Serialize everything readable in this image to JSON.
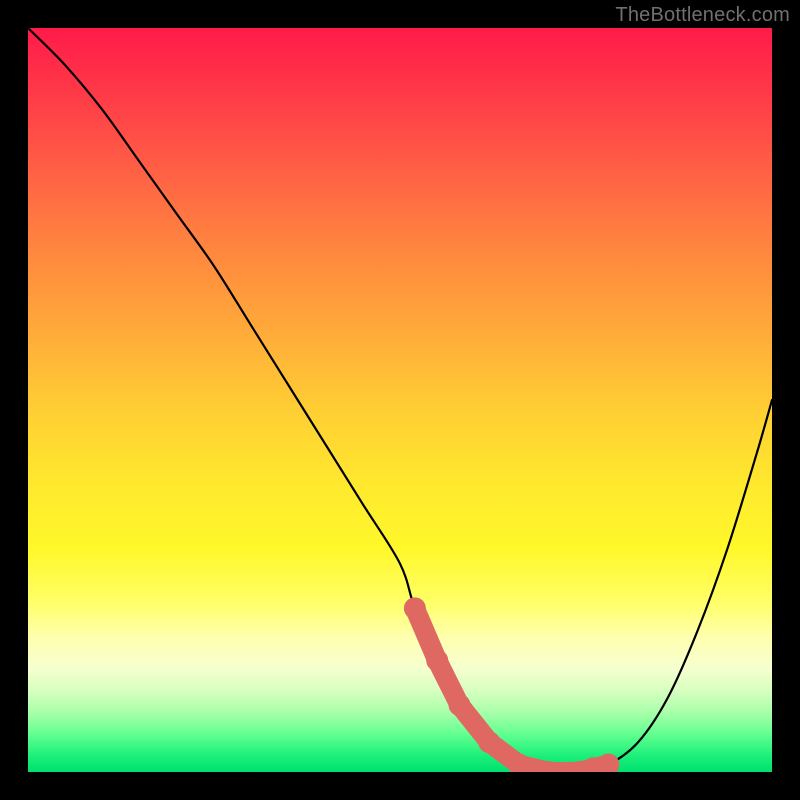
{
  "watermark": "TheBottleneck.com",
  "chart_data": {
    "type": "line",
    "title": "",
    "xlabel": "",
    "ylabel": "",
    "xlim": [
      0,
      100
    ],
    "ylim": [
      0,
      100
    ],
    "grid": false,
    "series": [
      {
        "name": "bottleneck-curve",
        "x": [
          0,
          5,
          10,
          15,
          20,
          25,
          30,
          35,
          40,
          45,
          50,
          52,
          55,
          58,
          62,
          66,
          70,
          74,
          78,
          82,
          86,
          90,
          94,
          98,
          100
        ],
        "y": [
          100,
          95,
          89,
          82,
          75,
          68,
          60,
          52,
          44,
          36,
          28,
          22,
          15,
          9,
          4,
          1,
          0,
          0,
          1,
          4,
          10,
          19,
          30,
          43,
          50
        ]
      }
    ],
    "optimal_markers": {
      "name": "optimal-range",
      "x": [
        52,
        55,
        58,
        62,
        66,
        70,
        74,
        76,
        78
      ],
      "y": [
        22,
        15,
        9,
        4,
        1,
        0,
        0,
        0.5,
        1
      ]
    },
    "gradient_scale": {
      "description": "vertical red-to-green bottleneck severity",
      "stops": [
        {
          "pos": 0,
          "color": "#ff1a4a"
        },
        {
          "pos": 50,
          "color": "#ffe030"
        },
        {
          "pos": 100,
          "color": "#00e070"
        }
      ]
    }
  }
}
